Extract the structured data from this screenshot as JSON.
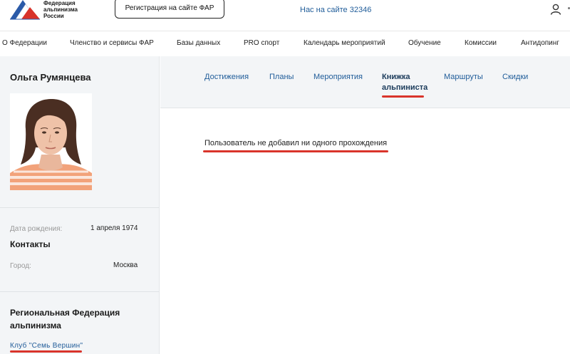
{
  "header": {
    "logo_lines": [
      "Федерация",
      "альпинизма",
      "России"
    ],
    "register_button": "Регистрация на сайте ФАР",
    "site_count": "Нас на сайте 32346"
  },
  "nav": {
    "items": [
      "О Федерации",
      "Членство и сервисы ФАР",
      "Базы данных",
      "PRO спорт",
      "Календарь мероприятий",
      "Обучение",
      "Комиссии",
      "Антидопинг"
    ]
  },
  "profile": {
    "name": "Ольга Румянцева",
    "birth_label": "Дата рождения:",
    "birth_value": "1 апреля 1974",
    "contacts_title": "Контакты",
    "city_label": "Город:",
    "city_value": "Москва",
    "federation_title": "Региональная Федерация альпинизма",
    "club": "Клуб \"Семь Вершин\""
  },
  "tabs": [
    {
      "label": "Достижения",
      "active": false
    },
    {
      "label": "Планы",
      "active": false
    },
    {
      "label": "Мероприятия",
      "active": false
    },
    {
      "label": "Книжка альпиниста",
      "active": true
    },
    {
      "label": "Маршруты",
      "active": false
    },
    {
      "label": "Скидки",
      "active": false
    }
  ],
  "content": {
    "empty_message": "Пользователь не добавил ни одного прохождения"
  },
  "colors": {
    "accent_blue": "#1f5c99",
    "highlight_red": "#d9342b",
    "sidebar_bg": "#f3f5f7"
  }
}
